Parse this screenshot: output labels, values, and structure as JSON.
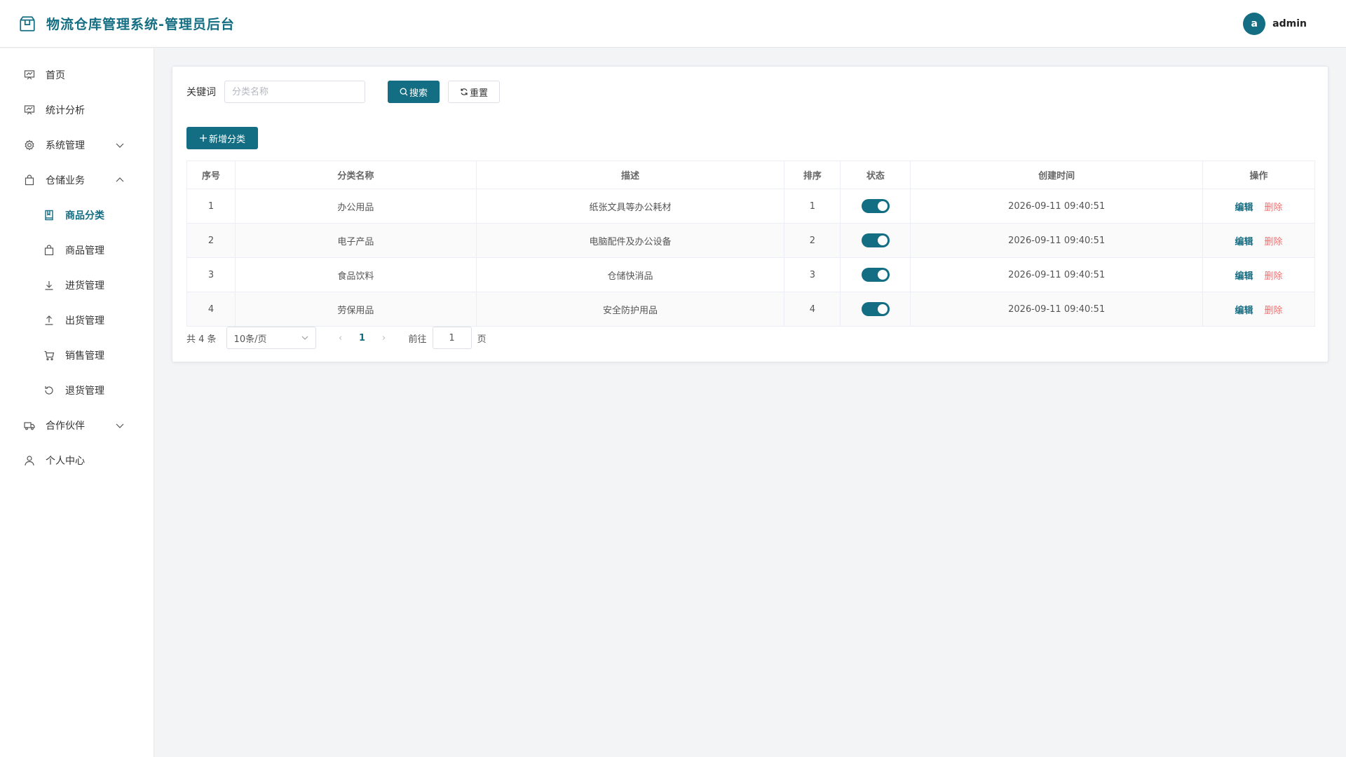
{
  "header": {
    "title": "物流仓库管理系统-管理员后台",
    "avatar_letter": "a",
    "username": "admin",
    "brand_color": "#136d83"
  },
  "sidebar": {
    "items": [
      {
        "label": "首页",
        "icon": "chart-board-icon"
      },
      {
        "label": "统计分析",
        "icon": "chart-board-icon"
      },
      {
        "label": "系统管理",
        "icon": "gear-icon",
        "expanded": false
      },
      {
        "label": "仓储业务",
        "icon": "bag-icon",
        "expanded": true
      },
      {
        "label": "商品分类",
        "icon": "book-icon",
        "active": true
      },
      {
        "label": "商品管理",
        "icon": "bag-icon"
      },
      {
        "label": "进货管理",
        "icon": "download-icon"
      },
      {
        "label": "出货管理",
        "icon": "upload-icon"
      },
      {
        "label": "销售管理",
        "icon": "cart-icon"
      },
      {
        "label": "退货管理",
        "icon": "refresh-icon"
      },
      {
        "label": "合作伙伴",
        "icon": "truck-icon",
        "expanded": false
      },
      {
        "label": "个人中心",
        "icon": "user-icon"
      }
    ]
  },
  "search": {
    "label": "关键词",
    "placeholder": "分类名称",
    "value": "",
    "search_button": "搜索",
    "reset_button": "重置"
  },
  "actions": {
    "add_button": "新增分类"
  },
  "table": {
    "headers": [
      "序号",
      "分类名称",
      "描述",
      "排序",
      "状态",
      "创建时间",
      "操作"
    ],
    "rows": [
      {
        "index": "1",
        "name": "办公用品",
        "desc": "纸张文具等办公耗材",
        "sort": "1",
        "enabled": true,
        "created": "2026-09-11 09:40:51"
      },
      {
        "index": "2",
        "name": "电子产品",
        "desc": "电脑配件及办公设备",
        "sort": "2",
        "enabled": true,
        "created": "2026-09-11 09:40:51"
      },
      {
        "index": "3",
        "name": "食品饮料",
        "desc": "仓储快消品",
        "sort": "3",
        "enabled": true,
        "created": "2026-09-11 09:40:51"
      },
      {
        "index": "4",
        "name": "劳保用品",
        "desc": "安全防护用品",
        "sort": "4",
        "enabled": true,
        "created": "2026-09-11 09:40:51"
      }
    ],
    "edit_label": "编辑",
    "delete_label": "删除"
  },
  "pager": {
    "total": "共 4 条",
    "page_size": "10条/页",
    "current_page": "1",
    "goto_label": "前往",
    "goto_value": "1",
    "page_unit": "页"
  }
}
